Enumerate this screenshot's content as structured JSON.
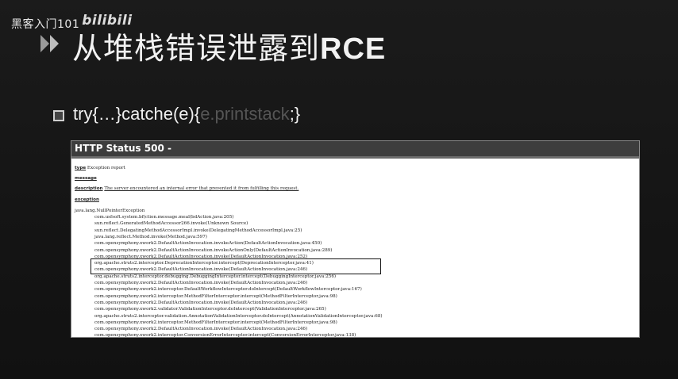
{
  "watermark": {
    "text": "黑客入门101",
    "bili": "bilibili"
  },
  "slide": {
    "title_cn": "从堆栈错误泄露到",
    "title_latin": "RCE",
    "code": {
      "part1": "try{…}catche(e){",
      "dim": "e.printstack",
      "part2": ";}"
    }
  },
  "screenshot": {
    "header": "HTTP Status 500 -",
    "type_label": "type",
    "type_value": "Exception report",
    "message_label": "message",
    "description_label": "description",
    "description_value": "The server encountered an internal error that prevented it from fulfilling this request.",
    "exception_label": "exception",
    "exception_first": "java.lang.NullPointerException",
    "stack": [
      "com.usfsoft.system.bf(ction.message.meal(bdAction.java:205)",
      "sun.reflect.GeneratedMethodAccessor266.invoke(Unknown Source)",
      "sun.reflect.DelegatingMethodAccessorImpl.invoke(DelegatingMethodAccessorImpl.java:25)",
      "java.lang.reflect.Method.invoke(Method.java:597)",
      "com.opensymphony.xwork2.DefaultActionInvocation.invokeAction(DefaultActionInvocation.java:450)",
      "com.opensymphony.xwork2.DefaultActionInvocation.invokeActionOnly(DefaultActionInvocation.java:289)",
      "com.opensymphony.xwork2.DefaultActionInvocation.invoke(DefaultActionInvocation.java:252)",
      "org.apache.struts2.interceptor.DeprecationInterceptor.intercept(DeprecationInterceptor.java:41)",
      "com.opensymphony.xwork2.DefaultActionInvocation.invoke(DefaultActionInvocation.java:246)",
      "org.apache.struts2.interceptor.debugging.DebuggingInterceptor.intercept(DebuggingInterceptor.java:256)",
      "com.opensymphony.xwork2.DefaultActionInvocation.invoke(DefaultActionInvocation.java:246)",
      "com.opensymphony.xwork2.interceptor.DefaultWorkflowInterceptor.doIntercept(DefaultWorkflowInterceptor.java:167)",
      "com.opensymphony.xwork2.interceptor.MethodFilterInterceptor.intercept(MethodFilterInterceptor.java:98)",
      "com.opensymphony.xwork2.DefaultActionInvocation.invoke(DefaultActionInvocation.java:246)",
      "com.opensymphony.xwork2.validator.ValidationInterceptor.doIntercept(ValidationInterceptor.java:265)",
      "org.apache.struts2.interceptor.validation.AnnotationValidationInterceptor.doIntercept(AnnotationValidationInterceptor.java:68)",
      "com.opensymphony.xwork2.interceptor.MethodFilterInterceptor.intercept(MethodFilterInterceptor.java:98)",
      "com.opensymphony.xwork2.DefaultActionInvocation.invoke(DefaultActionInvocation.java:246)",
      "com.opensymphony.xwork2.interceptor.ConversionErrorInterceptor.intercept(ConversionErrorInterceptor.java:138)"
    ]
  }
}
